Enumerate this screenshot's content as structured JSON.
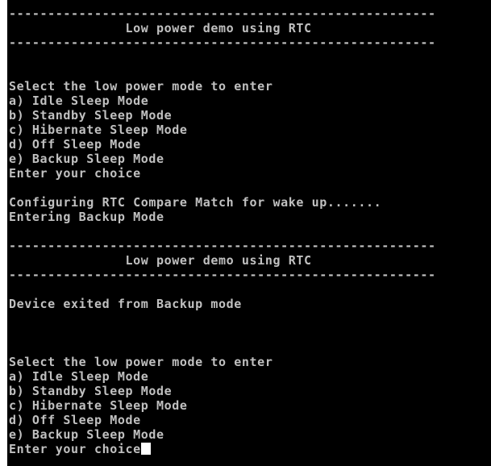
{
  "console": {
    "lines": [
      "-------------------------------------------------------",
      "               Low power demo using RTC",
      "-------------------------------------------------------",
      "",
      "",
      "Select the low power mode to enter",
      "a) Idle Sleep Mode",
      "b) Standby Sleep Mode",
      "c) Hibernate Sleep Mode",
      "d) Off Sleep Mode",
      "e) Backup Sleep Mode",
      "Enter your choice",
      "",
      "Configuring RTC Compare Match for wake up.......",
      "Entering Backup Mode",
      "",
      "-------------------------------------------------------",
      "               Low power demo using RTC",
      "-------------------------------------------------------",
      "",
      "Device exited from Backup mode",
      "",
      "",
      "",
      "Select the low power mode to enter",
      "a) Idle Sleep Mode",
      "b) Standby Sleep Mode",
      "c) Hibernate Sleep Mode",
      "d) Off Sleep Mode",
      "e) Backup Sleep Mode",
      "Enter your choice"
    ]
  },
  "colors": {
    "background": "#000000",
    "text": "#c0c0c0",
    "cursor": "#ffffff"
  }
}
